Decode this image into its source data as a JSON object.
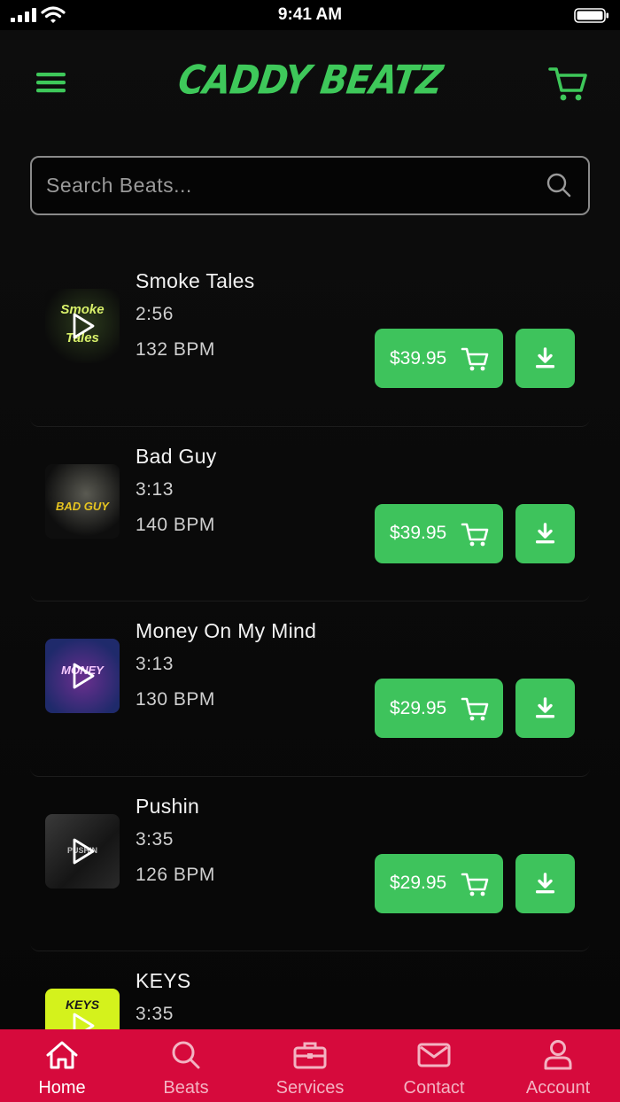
{
  "status_bar": {
    "time": "9:41 AM"
  },
  "header": {
    "brand": "CADDY BEATZ",
    "accent_color": "#3ec85a",
    "menu_icon": "hamburger-icon",
    "cart_icon": "cart-icon"
  },
  "search": {
    "placeholder": "Search Beats...",
    "value": ""
  },
  "beats": [
    {
      "title": "Smoke Tales",
      "duration": "2:56",
      "bpm": "132 BPM",
      "price": "$39.95",
      "cover_text": "Smoke Tales"
    },
    {
      "title": "Bad Guy",
      "duration": "3:13",
      "bpm": "140 BPM",
      "price": "$39.95",
      "cover_text": "BAD GUY"
    },
    {
      "title": "Money On My Mind",
      "duration": "3:13",
      "bpm": "130 BPM",
      "price": "$29.95",
      "cover_text": "MONEY"
    },
    {
      "title": "Pushin",
      "duration": "3:35",
      "bpm": "126 BPM",
      "price": "$29.95",
      "cover_text": "PUSHIN"
    },
    {
      "title": "KEYS",
      "duration": "3:35",
      "bpm": "",
      "price": "",
      "cover_text": "KEYS"
    }
  ],
  "tabbar": {
    "color": "#d60a3c",
    "tabs": [
      {
        "label": "Home",
        "icon": "home-icon",
        "active": true
      },
      {
        "label": "Beats",
        "icon": "search-icon",
        "active": false
      },
      {
        "label": "Services",
        "icon": "briefcase-icon",
        "active": false
      },
      {
        "label": "Contact",
        "icon": "envelope-icon",
        "active": false
      },
      {
        "label": "Account",
        "icon": "user-icon",
        "active": false
      }
    ]
  }
}
